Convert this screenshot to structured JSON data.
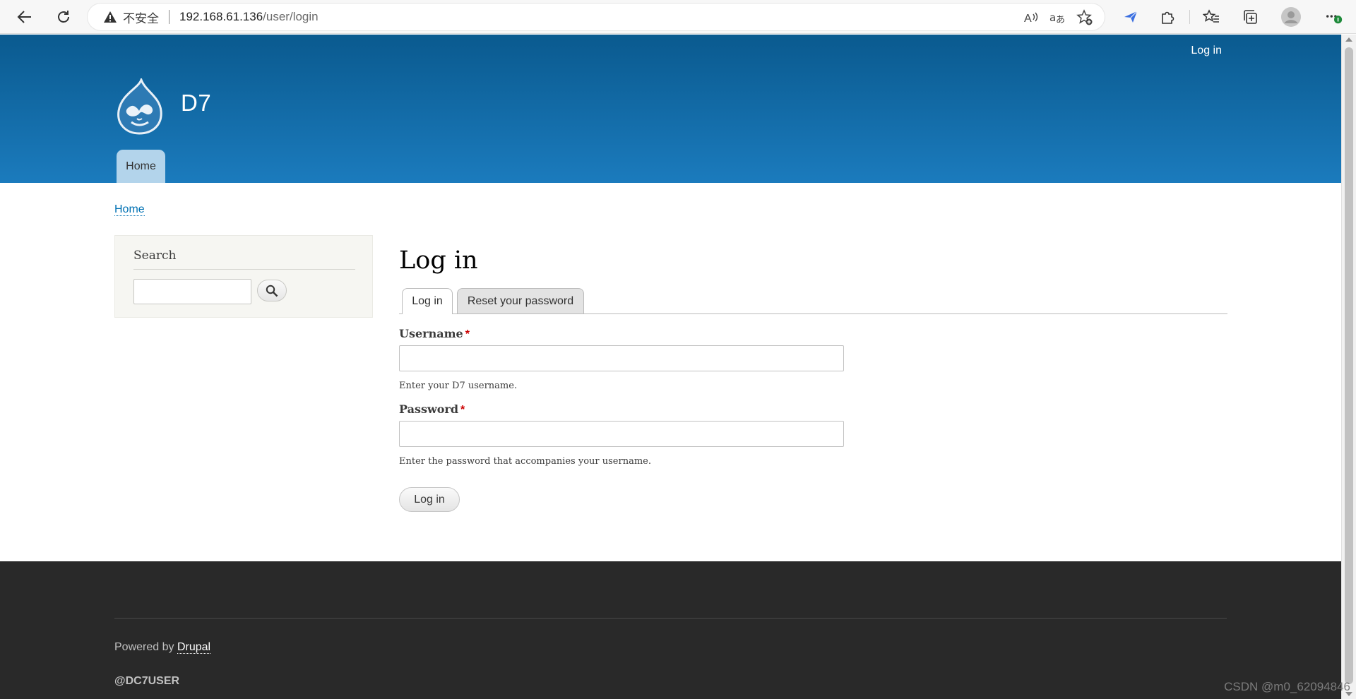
{
  "browser": {
    "security_label": "不安全",
    "url_host": "192.168.61.136",
    "url_path": "/user/login",
    "icons": [
      "back-icon",
      "refresh-icon",
      "warning-icon",
      "read-aloud-icon",
      "translate-icon",
      "add-favorite-icon",
      "extension-bird-icon",
      "extensions-icon",
      "favorites-icon",
      "collections-icon",
      "profile-icon",
      "more-icon"
    ]
  },
  "header": {
    "site_name": "D7",
    "secondary_login": "Log in",
    "main_menu": {
      "home": "Home"
    },
    "colors": {
      "gradient_top": "#0a5a8f",
      "gradient_bottom": "#1b7bbd",
      "tab_bg": "#b3d4eb"
    }
  },
  "breadcrumb": {
    "home": "Home"
  },
  "sidebar": {
    "search_title": "Search",
    "search_placeholder": ""
  },
  "content": {
    "title": "Log in",
    "tabs": [
      {
        "label": "Log in",
        "active": true
      },
      {
        "label": "Reset your password",
        "active": false
      }
    ],
    "username": {
      "label": "Username",
      "required": "*",
      "value": "",
      "description": "Enter your D7 username."
    },
    "password": {
      "label": "Password",
      "required": "*",
      "value": "",
      "description": "Enter the password that accompanies your username."
    },
    "submit_label": "Log in"
  },
  "footer": {
    "powered_prefix": "Powered by ",
    "powered_link": "Drupal",
    "dc7": "@DC7USER"
  },
  "watermark": "CSDN @m0_62094846"
}
